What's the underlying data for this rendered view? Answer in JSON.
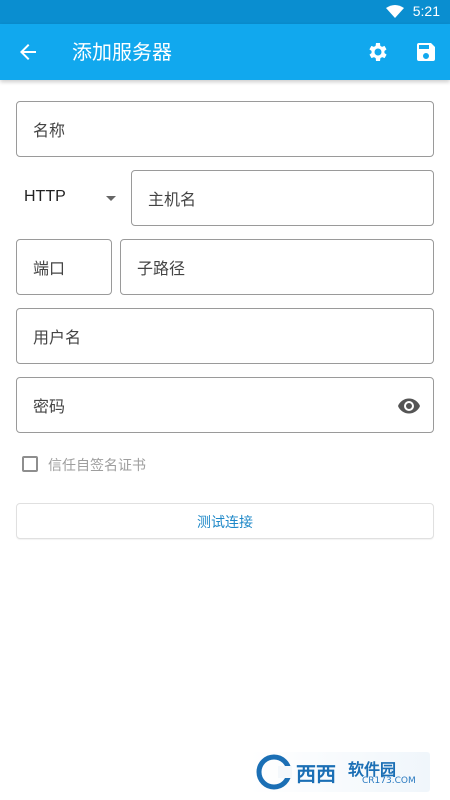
{
  "status_bar": {
    "time": "5:21"
  },
  "app_bar": {
    "title": "添加服务器"
  },
  "form": {
    "name_placeholder": "名称",
    "protocol_value": "HTTP",
    "host_placeholder": "主机名",
    "port_placeholder": "端口",
    "path_placeholder": "子路径",
    "user_placeholder": "用户名",
    "password_placeholder": "密码",
    "self_signed_label": "信任自签名证书",
    "self_signed_checked": false,
    "test_button": "测试连接"
  },
  "watermark": {
    "brand": "西西",
    "brand_suffix": "软件园",
    "url": "CR173.COM"
  },
  "colors": {
    "app_bar": "#11a8ee",
    "status_bar": "#0a8ed0",
    "accent_text": "#1e88c8"
  }
}
